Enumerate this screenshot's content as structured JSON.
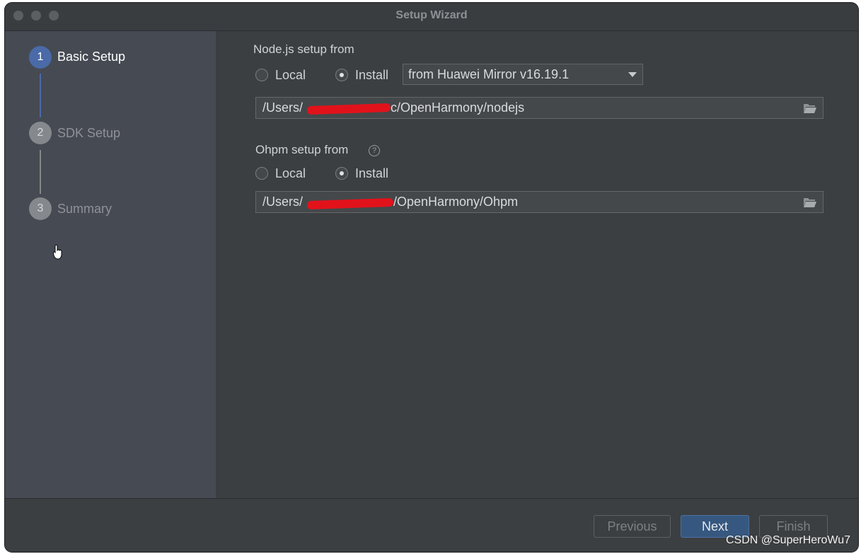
{
  "window": {
    "title": "Setup Wizard"
  },
  "steps": [
    {
      "number": "1",
      "label": "Basic Setup",
      "state": "active"
    },
    {
      "number": "2",
      "label": "SDK Setup",
      "state": "inactive"
    },
    {
      "number": "3",
      "label": "Summary",
      "state": "inactive"
    }
  ],
  "nodejs": {
    "label": "Node.js setup from",
    "option_local": "Local",
    "option_install": "Install",
    "selected": "Install",
    "mirror": "from Huawei Mirror v16.19.1",
    "path_prefix": "/Users/",
    "path_suffix": "c/OpenHarmony/nodejs"
  },
  "ohpm": {
    "label": "Ohpm setup from",
    "help": "?",
    "option_local": "Local",
    "option_install": "Install",
    "selected": "Install",
    "path_prefix": "/Users/",
    "path_suffix": "/OpenHarmony/Ohpm"
  },
  "buttons": {
    "previous": "Previous",
    "next": "Next",
    "finish": "Finish"
  },
  "watermark": "CSDN @SuperHeroWu7",
  "colors": {
    "accent": "#4a6aa8",
    "redaction": "#e2121b",
    "primary_button": "#365880"
  }
}
